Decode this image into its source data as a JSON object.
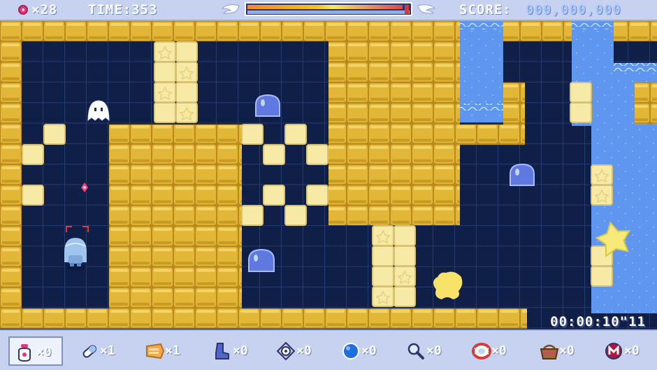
{
  "hud": {
    "gem_count": "×28",
    "time_label": "TIME:353",
    "score_label": "SCORE:",
    "score_value": "000,000,000",
    "level_progress": 0.99
  },
  "timer": "00:00:10\"11",
  "colors": {
    "wall": "#e2b737",
    "wall_light": "#f7e9a6",
    "floor": "#0f1f47",
    "grid": "#22376a",
    "water": "#5e96f0",
    "hud_bg": "#c6d2ef",
    "gem": "#e8357c",
    "slime": "#5f79e0",
    "star": "#f7ea78"
  },
  "items": [
    {
      "icon": "pot-icon",
      "count": "×0",
      "selected": true
    },
    {
      "icon": "capsule-icon",
      "count": "×1",
      "selected": false
    },
    {
      "icon": "megaphone-icon",
      "count": "×1",
      "selected": false
    },
    {
      "icon": "boot-icon",
      "count": "×0",
      "selected": false
    },
    {
      "icon": "target-icon",
      "count": "×0",
      "selected": false
    },
    {
      "icon": "blue-orb-icon",
      "count": "×0",
      "selected": false
    },
    {
      "icon": "magnifier-icon",
      "count": "×0",
      "selected": false
    },
    {
      "icon": "lifebuoy-icon",
      "count": "×0",
      "selected": false
    },
    {
      "icon": "basket-icon",
      "count": "×0",
      "selected": false
    },
    {
      "icon": "m-badge-icon",
      "count": "×0",
      "selected": false
    }
  ]
}
